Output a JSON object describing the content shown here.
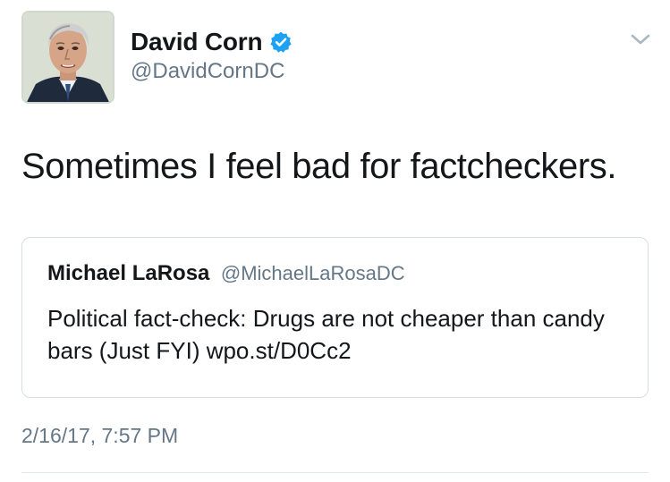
{
  "author": {
    "display_name": "David Corn",
    "handle": "@DavidCornDC",
    "verified": true,
    "avatar_icon": "profile-photo"
  },
  "tweet": {
    "text": "Sometimes I feel bad for factcheckers.",
    "timestamp": "2/16/17, 7:57 PM"
  },
  "quoted_tweet": {
    "display_name": "Michael LaRosa",
    "handle": "@MichaelLaRosaDC",
    "text": "Political fact-check: Drugs are not cheaper than candy bars (Just FYI) wpo.st/D0Cc2"
  },
  "icons": {
    "verified": "verified-badge-icon",
    "menu": "chevron-down-icon"
  },
  "colors": {
    "verified_blue": "#1da1f2",
    "secondary_text": "#657786",
    "primary_text": "#14171a",
    "border": "#d6dde3"
  }
}
